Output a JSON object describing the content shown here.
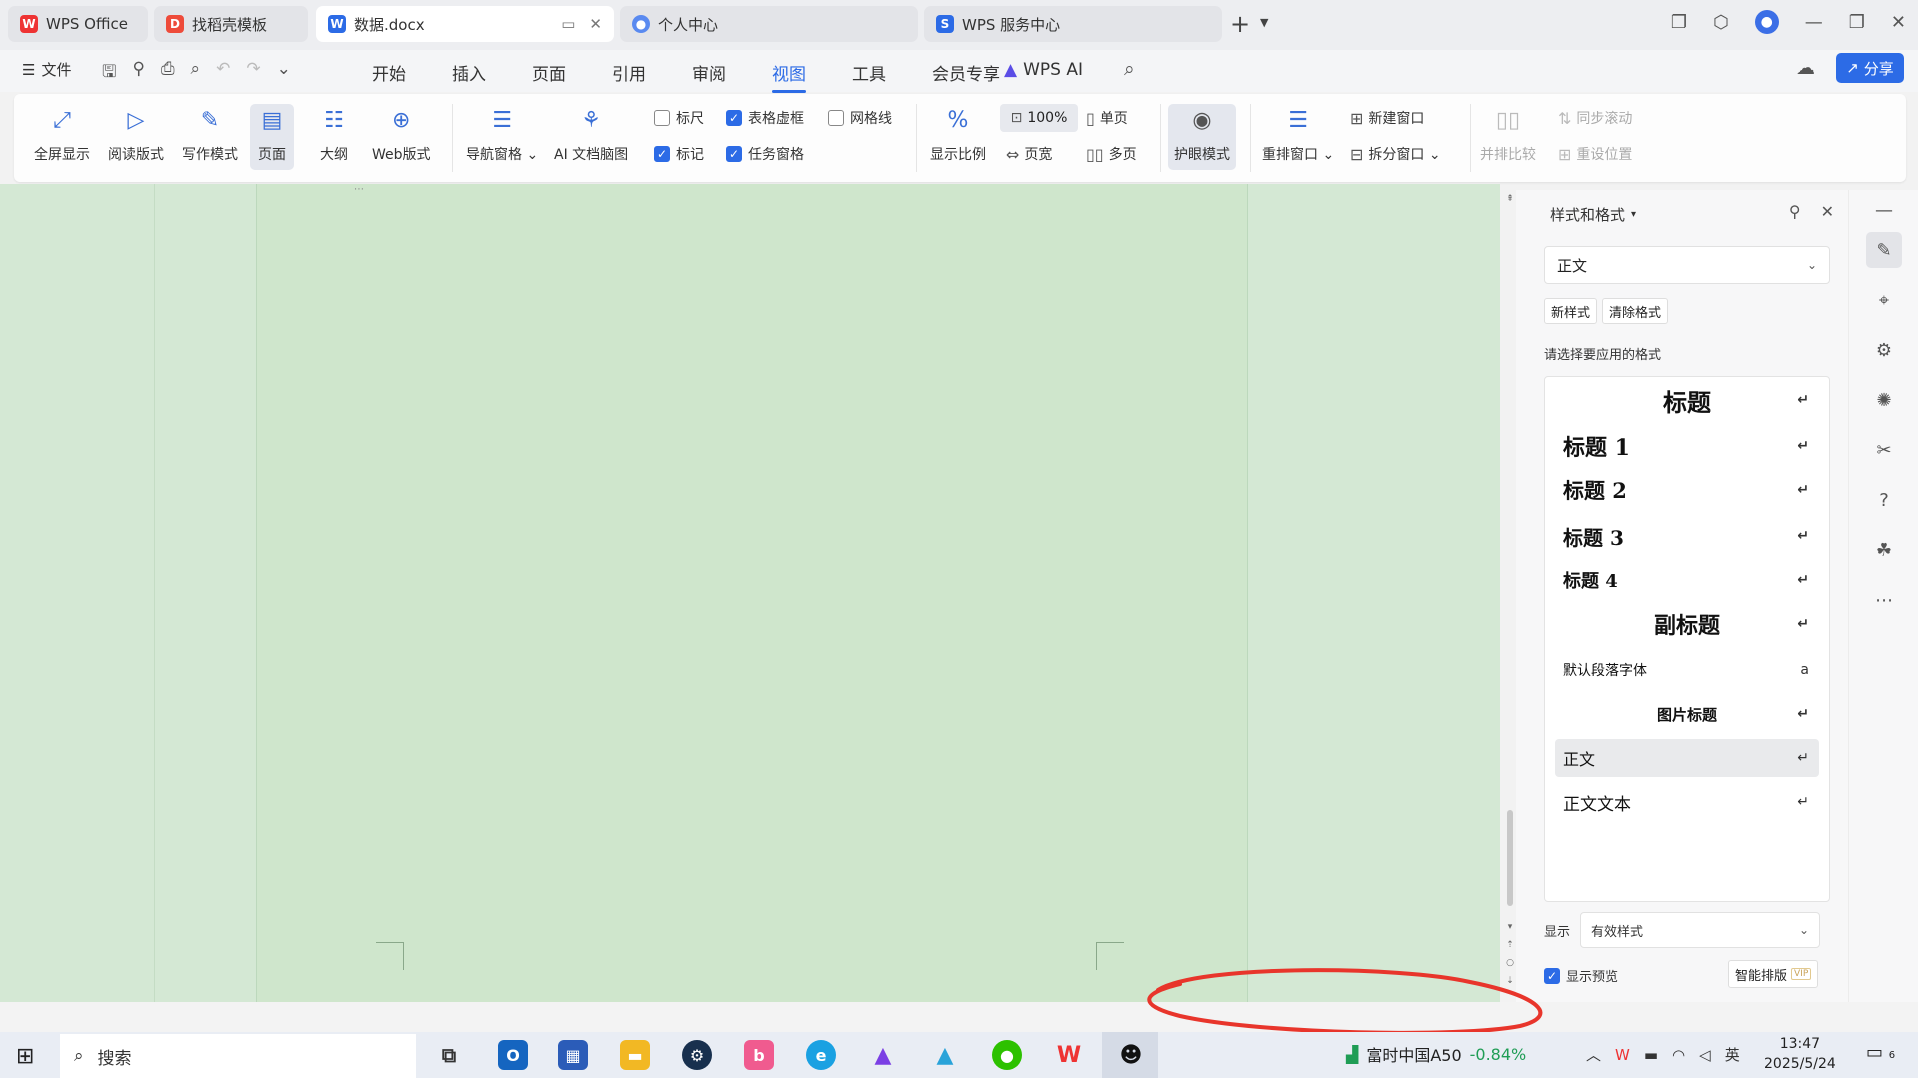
{
  "tabs": [
    {
      "label": "WPS Office",
      "icon": "wps-logo-icon"
    },
    {
      "label": "找稻壳模板",
      "icon": "docer-icon"
    },
    {
      "label": "数据.docx",
      "icon": "word-doc-icon"
    },
    {
      "label": "个人中心",
      "icon": "user-center-icon"
    },
    {
      "label": "WPS 服务中心",
      "icon": "service-center-icon"
    }
  ],
  "menu": {
    "file_label": "文件",
    "items": [
      "开始",
      "插入",
      "页面",
      "引用",
      "审阅",
      "视图",
      "工具",
      "会员专享"
    ],
    "active": "视图",
    "ai_label": "WPS AI",
    "share_label": "分享"
  },
  "ribbon": {
    "fullscreen": "全屏显示",
    "reading": "阅读版式",
    "writing": "写作模式",
    "page": "页面",
    "outline": "大纲",
    "web": "Web版式",
    "nav_pane": "导航窗格",
    "ai_mindmap": "AI 文档脑图",
    "ruler": "标尺",
    "table_gridlines": "表格虚框",
    "gridlines": "网格线",
    "marks": "标记",
    "task_pane": "任务窗格",
    "zoom_ratio": "显示比例",
    "zoom_value": "100%",
    "single_page": "单页",
    "page_width": "页宽",
    "multi_page": "多页",
    "eye_protect": "护眼模式",
    "arrange_windows": "重排窗口",
    "new_window": "新建窗口",
    "split_window": "拆分窗口",
    "side_by_side": "并排比较",
    "sync_scroll": "同步滚动",
    "reset_position": "重设位置"
  },
  "checkboxes": {
    "ruler": false,
    "table_gridlines": true,
    "gridlines": false,
    "marks": true,
    "task_pane": true
  },
  "panel": {
    "title": "样式和格式",
    "current_style": "正文",
    "new_style": "新样式",
    "clear_format": "清除格式",
    "hint": "请选择要应用的格式",
    "styles": [
      "标题",
      "标题 1",
      "标题 2",
      "标题 3",
      "标题 4",
      "副标题",
      "默认段落字体",
      "图片标题",
      "正文",
      "正文文本"
    ],
    "selected_style": "正文",
    "show_label": "显示",
    "show_value": "有效样式",
    "show_preview": "显示预览",
    "show_preview_checked": true,
    "smart_layout": "智能排版",
    "vip_badge": "VIP"
  },
  "taskbar": {
    "search_placeholder": "搜索",
    "stock_name": "富时中国A50",
    "stock_change": "-0.84%",
    "ime": "英",
    "time": "13:47",
    "date": "2025/5/24",
    "notifications": "6"
  },
  "colors": {
    "accent": "#2c6be6",
    "doc_background": "#cfe6cc",
    "annotation": "#e8352b",
    "stock_change": "#1f9d55"
  }
}
